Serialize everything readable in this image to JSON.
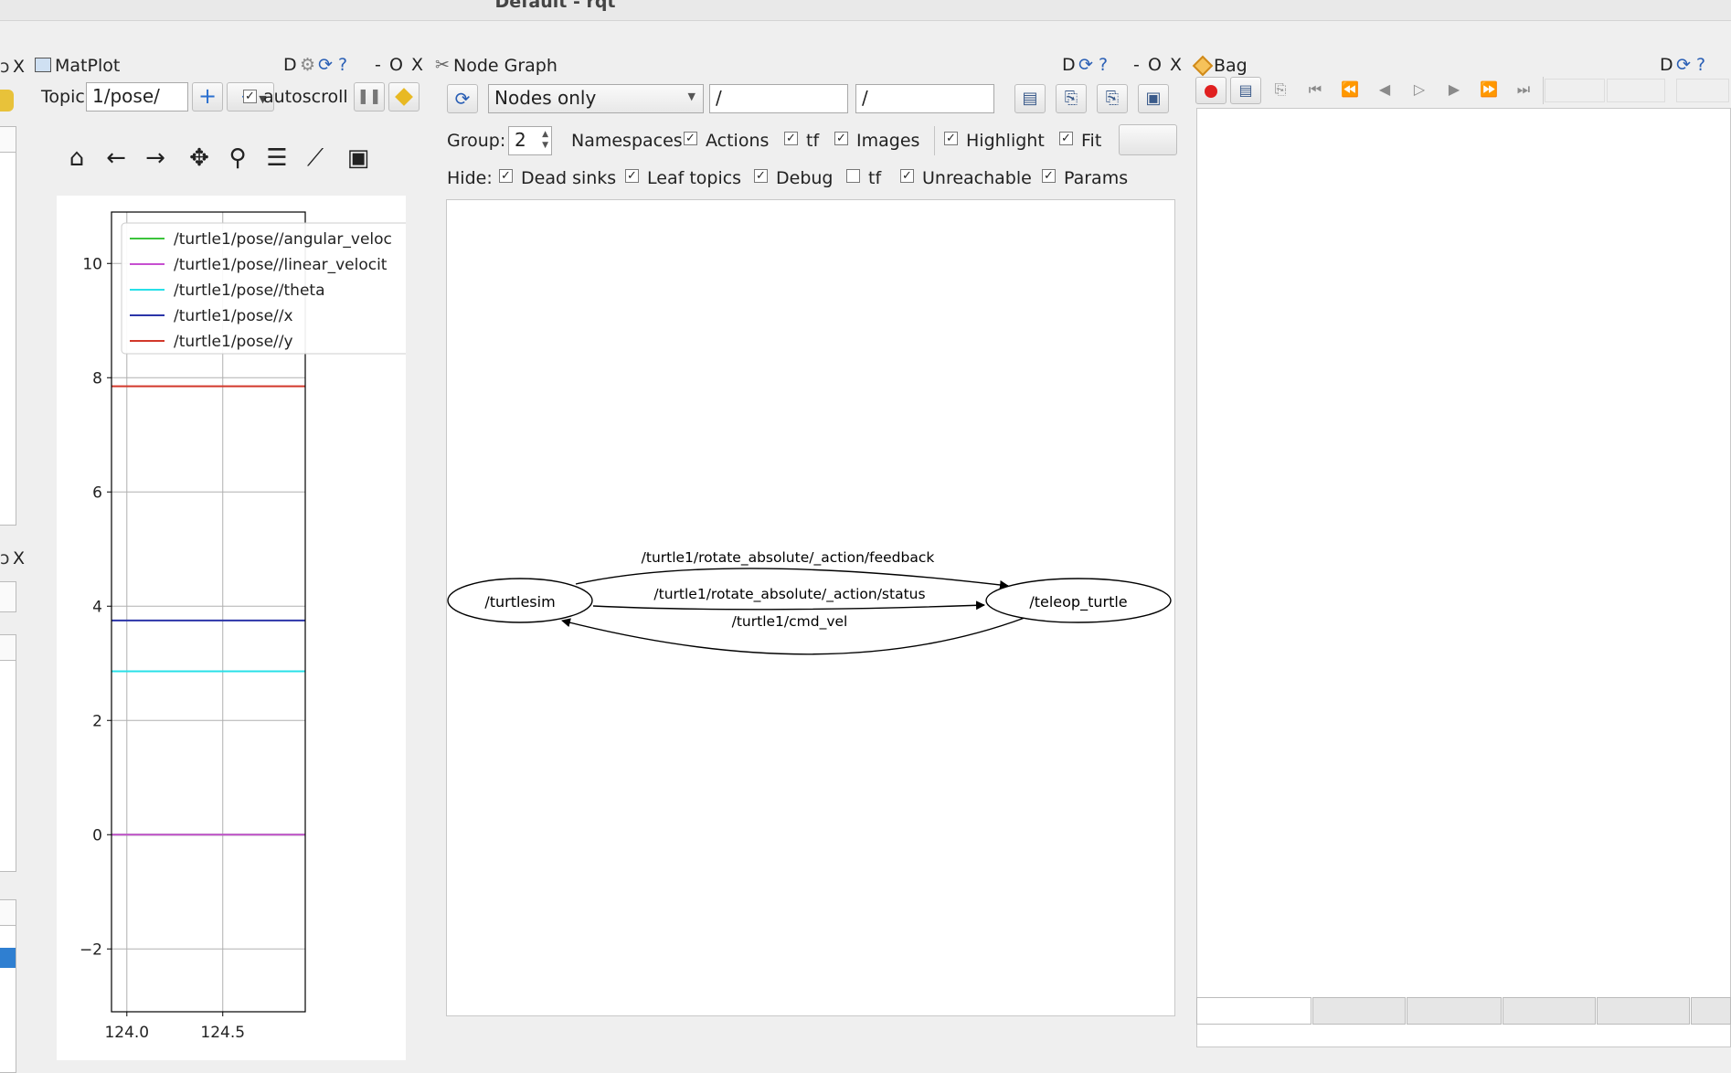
{
  "window": {
    "title": "Default - rqt"
  },
  "left_dock": {
    "close_label": "X",
    "close_label_2": "X"
  },
  "matplot": {
    "title": "MatPlot",
    "controls": {
      "d": "D",
      "dash": "-",
      "o": "O",
      "x": "X"
    },
    "topic_label": "Topic",
    "topic_value": "1/pose/",
    "add_icon": "+",
    "remove_icon": "−",
    "autoscroll_checked": true,
    "autoscroll_label": "autoscroll",
    "toolbar_icons": [
      "home-icon",
      "back-arrow-icon",
      "forward-arrow-icon",
      "pan-icon",
      "zoom-icon",
      "configure-icon",
      "edit-axis-icon",
      "save-icon"
    ]
  },
  "node_graph": {
    "title": "Node Graph",
    "controls": {
      "d": "D",
      "dash": "-",
      "o": "O",
      "x": "X"
    },
    "mode_value": "Nodes only",
    "filter1": "/",
    "filter2": "/",
    "group_label": "Group:",
    "group_value": "2",
    "row1": [
      {
        "label": "Namespaces",
        "checked": false
      },
      {
        "label": "Actions",
        "checked": true
      },
      {
        "label": "tf",
        "checked": true
      },
      {
        "label": "Images",
        "checked": true
      },
      {
        "label": "Highlight",
        "checked": true
      },
      {
        "label": "Fit",
        "checked": true
      }
    ],
    "hide_label": "Hide:",
    "row2": [
      {
        "label": "Dead sinks",
        "checked": true
      },
      {
        "label": "Leaf topics",
        "checked": true
      },
      {
        "label": "Debug",
        "checked": true
      },
      {
        "label": "tf",
        "checked": false
      },
      {
        "label": "Unreachable",
        "checked": true
      },
      {
        "label": "Params",
        "checked": true
      }
    ],
    "graph": {
      "nodes": [
        "/turtlesim",
        "/teleop_turtle"
      ],
      "edges": [
        "/turtle1/rotate_absolute/_action/feedback",
        "/turtle1/rotate_absolute/_action/status",
        "/turtle1/cmd_vel"
      ]
    }
  },
  "bag": {
    "title": "Bag",
    "controls": {
      "d": "D"
    }
  },
  "chart_data": {
    "type": "line",
    "title": "",
    "xlabel": "",
    "ylabel": "",
    "x_ticks": [
      "124.0",
      "124.5"
    ],
    "y_ticks": [
      "10",
      "8",
      "6",
      "4",
      "2",
      "0",
      "−2"
    ],
    "xlim": [
      123.92,
      124.93
    ],
    "ylim": [
      -3.1,
      10.9
    ],
    "grid": true,
    "legend_position": "top-right",
    "series": [
      {
        "name": "/turtle1/pose//angular_veloc",
        "color": "#3cc43c",
        "x": [
          123.92,
          124.93
        ],
        "y": [
          0.0,
          0.0
        ]
      },
      {
        "name": "/turtle1/pose//linear_velocit",
        "color": "#c74fd0",
        "x": [
          123.92,
          124.93
        ],
        "y": [
          0.0,
          0.0
        ]
      },
      {
        "name": "/turtle1/pose//theta",
        "color": "#28e0e8",
        "x": [
          123.92,
          124.93
        ],
        "y": [
          2.86,
          2.86
        ]
      },
      {
        "name": "/turtle1/pose//x",
        "color": "#2b35a8",
        "x": [
          123.92,
          124.93
        ],
        "y": [
          3.75,
          3.75
        ]
      },
      {
        "name": "/turtle1/pose//y",
        "color": "#d2382b",
        "x": [
          123.92,
          124.93
        ],
        "y": [
          7.85,
          7.85
        ]
      }
    ]
  }
}
